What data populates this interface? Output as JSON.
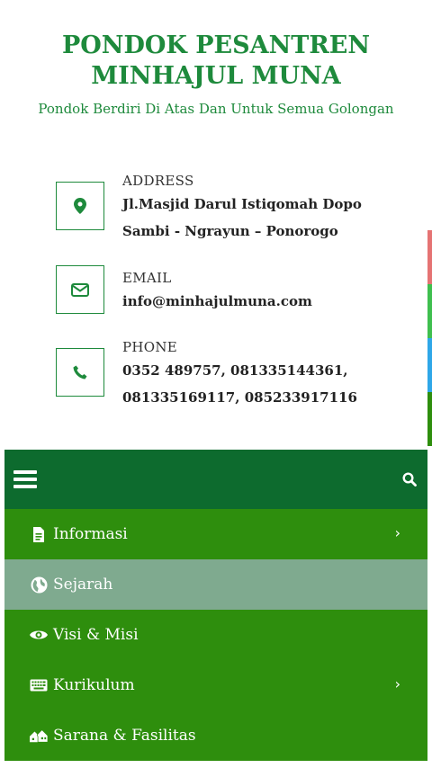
{
  "header": {
    "title_line1": "PONDOK PESANTREN",
    "title_line2": "MINHAJUL MUNA",
    "tagline": "Pondok Berdiri Di Atas Dan Untuk Semua Golongan"
  },
  "contacts": {
    "address": {
      "label": "ADDRESS",
      "line1": "Jl.Masjid Darul Istiqomah Dopo",
      "line2": "Sambi - Ngrayun – Ponorogo",
      "icon": "map-marker-icon"
    },
    "email": {
      "label": "EMAIL",
      "value": "info@minhajulmuna.com",
      "icon": "envelope-icon"
    },
    "phone": {
      "label": "PHONE",
      "line1": "0352 489757, 081335144361,",
      "line2": "081335169117, 085233917116",
      "icon": "phone-icon"
    }
  },
  "side_tabs_colors": [
    "#e57373",
    "#3fbf4f",
    "#2fa7e8",
    "#2e8e0d"
  ],
  "navbar": {
    "bg": "#0d6b2e",
    "menu_icon": "hamburger-icon",
    "search_icon": "search-icon"
  },
  "menu": {
    "items": [
      {
        "label": "Informasi",
        "icon": "document-icon",
        "has_submenu": true
      },
      {
        "label": "Sejarah",
        "icon": "globe-icon",
        "has_submenu": false,
        "active": true
      },
      {
        "label": "Visi & Misi",
        "icon": "eye-icon",
        "has_submenu": false
      },
      {
        "label": "Kurikulum",
        "icon": "keyboard-icon",
        "has_submenu": true
      },
      {
        "label": "Sarana & Fasilitas",
        "icon": "buildings-icon",
        "has_submenu": false
      }
    ],
    "chevron": "›"
  },
  "colors": {
    "brand_green": "#1e8a3c",
    "menu_green": "#2e8e0d",
    "active_item": "#7faa8f"
  }
}
